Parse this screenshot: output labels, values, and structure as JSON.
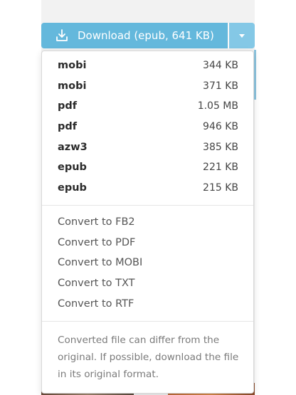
{
  "download_button": {
    "label": "Download (epub, 641 KB)",
    "icon": "download-icon",
    "color": "#64b8dc"
  },
  "dropdown_toggle": {
    "icon": "caret-down-icon",
    "color": "#84c8e6"
  },
  "files": [
    {
      "format": "mobi",
      "size": "344 KB"
    },
    {
      "format": "mobi",
      "size": "371 KB"
    },
    {
      "format": "pdf",
      "size": "1.05 MB"
    },
    {
      "format": "pdf",
      "size": "946 KB"
    },
    {
      "format": "azw3",
      "size": "385 KB"
    },
    {
      "format": "epub",
      "size": "221 KB"
    },
    {
      "format": "epub",
      "size": "215 KB"
    }
  ],
  "convert_options": [
    {
      "label": "Convert to FB2"
    },
    {
      "label": "Convert to PDF"
    },
    {
      "label": "Convert to MOBI"
    },
    {
      "label": "Convert to TXT"
    },
    {
      "label": "Convert to RTF"
    }
  ],
  "note": "Converted file can differ from the original. If possible, download the file in its original format."
}
